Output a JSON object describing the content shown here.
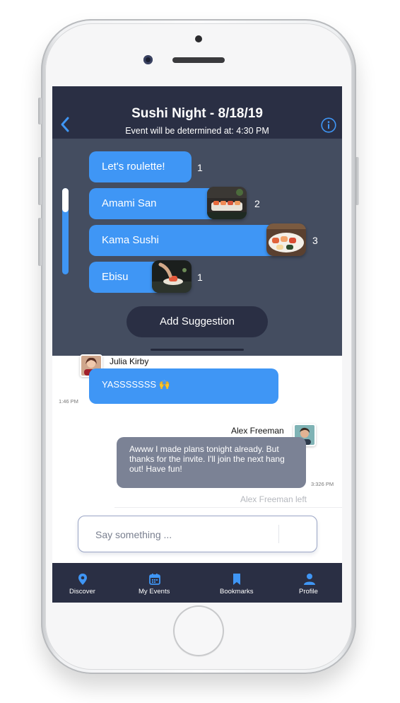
{
  "header": {
    "title": "Sushi Night - 8/18/19",
    "subtitle": "Event will be determined at: 4:30 PM"
  },
  "poll": {
    "options": [
      {
        "label": "Let's roulette!",
        "votes": "1"
      },
      {
        "label": "Amami San",
        "votes": "2"
      },
      {
        "label": "Kama Sushi",
        "votes": "3"
      },
      {
        "label": "Ebisu",
        "votes": "1"
      }
    ],
    "add_label": "Add Suggestion"
  },
  "chat": {
    "messages": [
      {
        "sender": "Julia Kirby",
        "text": "YASSSSSSS 🙌",
        "time": "1:46 PM"
      },
      {
        "sender": "Alex Freeman",
        "text": "Awww I made plans tonight already. But thanks for the invite. I'll join the next hang out! Have fun!",
        "time": "3:326 PM"
      }
    ],
    "system": "Alex Freeman left"
  },
  "composer": {
    "placeholder": "Say something ..."
  },
  "tabs": [
    {
      "label": "Discover",
      "icon": "location-pin-icon"
    },
    {
      "label": "My Events",
      "icon": "calendar-icon"
    },
    {
      "label": "Bookmarks",
      "icon": "bookmark-icon"
    },
    {
      "label": "Profile",
      "icon": "person-icon"
    }
  ],
  "colors": {
    "accent": "#3f96f5",
    "header_bg": "#2a2f44",
    "panel_bg": "#444d60",
    "outgoing_bubble": "#7b8295"
  }
}
